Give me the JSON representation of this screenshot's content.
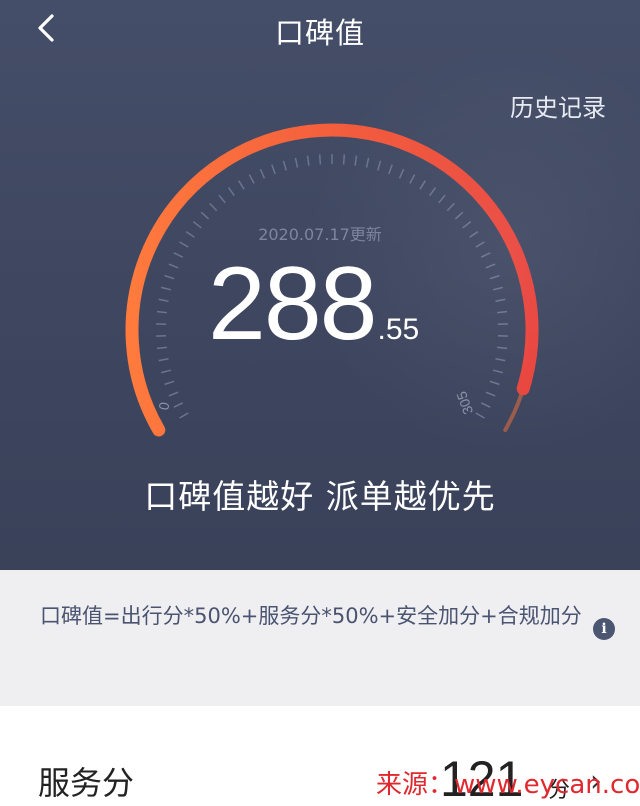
{
  "nav": {
    "title": "口碑值"
  },
  "header": {
    "history_label": "历史记录"
  },
  "gauge": {
    "update_text": "2020.07.17更新",
    "score_int": "288",
    "score_decimal": ".55",
    "min_label": "0",
    "max_label": "305",
    "min": 0,
    "max": 305,
    "value": 288.55,
    "arc_color_start": "#ff7a3d",
    "arc_color_end": "#e8433c"
  },
  "slogan": "口碑值越好 派单越优先",
  "formula": {
    "text": "口碑值=出行分*50%+服务分*50%+安全加分+合规加分"
  },
  "service": {
    "label": "服务分",
    "value": "121",
    "unit": "分"
  },
  "watermark": "来源：www.eycan.com"
}
